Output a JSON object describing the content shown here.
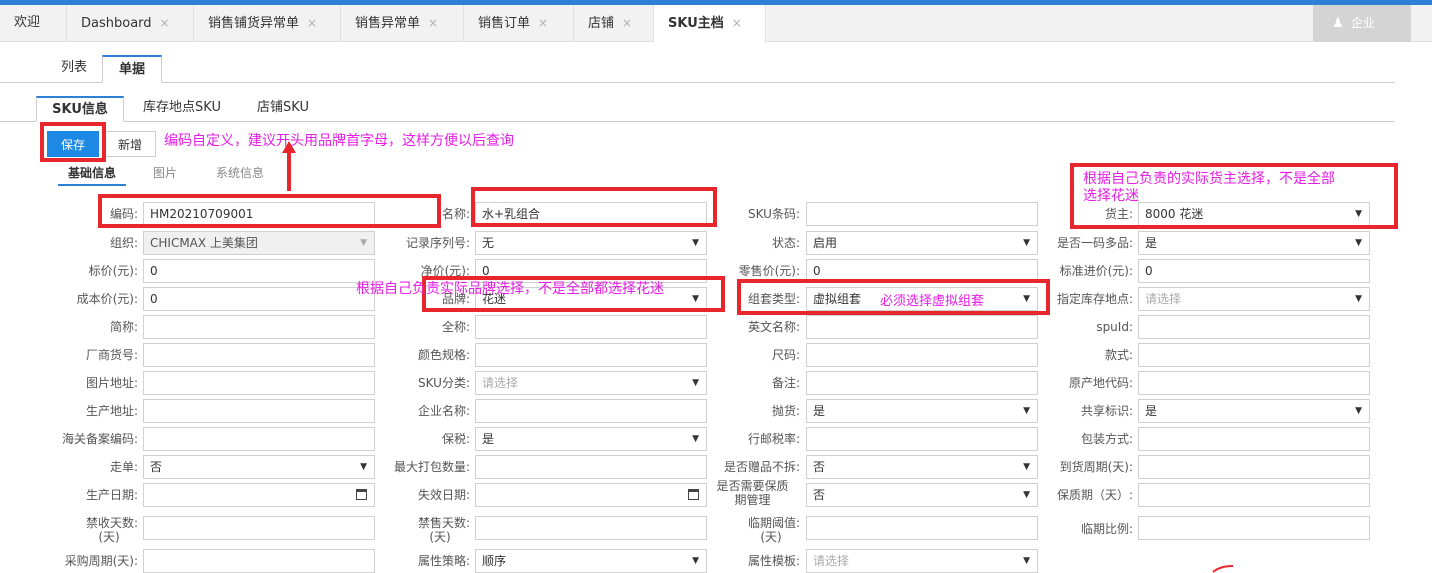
{
  "tabs": [
    {
      "label": "欢迎",
      "closable": false
    },
    {
      "label": "Dashboard",
      "closable": true
    },
    {
      "label": "销售铺货异常单",
      "closable": true
    },
    {
      "label": "销售异常单",
      "closable": true
    },
    {
      "label": "销售订单",
      "closable": true
    },
    {
      "label": "店铺",
      "closable": true
    },
    {
      "label": "SKU主档",
      "closable": true,
      "active": true
    }
  ],
  "close_glyph": "×",
  "user_corner": {
    "icon": "user-icon",
    "text": "企业"
  },
  "view_tabs": [
    "列表",
    "单据"
  ],
  "sku_tabs": [
    "SKU信息",
    "库存地点SKU",
    "店铺SKU"
  ],
  "buttons": {
    "save": "保存",
    "new": "新增"
  },
  "info_tabs": [
    "基础信息",
    "图片",
    "系统信息"
  ],
  "fields": {
    "code": {
      "label": "编码:",
      "value": "HM20210709001"
    },
    "name": {
      "label": "名称:",
      "value": "水+乳组合"
    },
    "sku_barcode": {
      "label": "SKU条码:",
      "value": ""
    },
    "owner": {
      "label": "货主:",
      "value": "8000 花迷"
    },
    "org": {
      "label": "组织:",
      "value": "CHICMAX 上美集团"
    },
    "serial_no": {
      "label": "记录序列号:",
      "value": "无"
    },
    "status": {
      "label": "状态:",
      "value": "启用"
    },
    "one_code_multi": {
      "label": "是否一码多品:",
      "value": "是"
    },
    "list_price": {
      "label": "标价(元):",
      "value": "0"
    },
    "net_price": {
      "label": "净价(元):",
      "value": "0"
    },
    "retail_price": {
      "label": "零售价(元):",
      "value": "0"
    },
    "std_cost_in": {
      "label": "标准进价(元):",
      "value": "0"
    },
    "cost_price": {
      "label": "成本价(元):",
      "value": "0"
    },
    "brand": {
      "label": "品牌:",
      "value": "花迷"
    },
    "kit_type": {
      "label": "组套类型:",
      "value": "虚拟组套"
    },
    "stock_location": {
      "label": "指定库存地点:",
      "placeholder": "请选择"
    },
    "short_name": {
      "label": "简称:",
      "value": ""
    },
    "full_name": {
      "label": "全称:",
      "value": ""
    },
    "english_name": {
      "label": "英文名称:",
      "value": ""
    },
    "spuid": {
      "label": "spuId:",
      "value": ""
    },
    "vendor_no": {
      "label": "厂商货号:",
      "value": ""
    },
    "color_spec": {
      "label": "颜色规格:",
      "value": ""
    },
    "size": {
      "label": "尺码:",
      "value": ""
    },
    "style": {
      "label": "款式:",
      "value": ""
    },
    "image_url": {
      "label": "图片地址:",
      "value": ""
    },
    "sku_category": {
      "label": "SKU分类:",
      "placeholder": "请选择"
    },
    "remark": {
      "label": "备注:",
      "value": ""
    },
    "origin_code": {
      "label": "原产地代码:",
      "value": ""
    },
    "prod_address": {
      "label": "生产地址:",
      "value": ""
    },
    "company": {
      "label": "企业名称:",
      "value": ""
    },
    "throw_goods": {
      "label": "抛货:",
      "value": "是"
    },
    "shared_flag": {
      "label": "共享标识:",
      "value": "是"
    },
    "customs_code": {
      "label": "海关备案编码:",
      "value": ""
    },
    "bonded": {
      "label": "保税:",
      "value": "是"
    },
    "postal_tax": {
      "label": "行邮税率:",
      "value": ""
    },
    "packing": {
      "label": "包装方式:",
      "value": ""
    },
    "walk_order": {
      "label": "走单:",
      "value": "否"
    },
    "max_pack_qty": {
      "label": "最大打包数量:",
      "value": ""
    },
    "gift_no_split": {
      "label": "是否赠品不拆:",
      "value": "否"
    },
    "arrival_cycle": {
      "label": "到货周期(天):",
      "value": ""
    },
    "prod_date": {
      "label": "生产日期:",
      "value": ""
    },
    "expiry_date": {
      "label": "失效日期:",
      "value": ""
    },
    "shelf_mgmt": {
      "label_line1": "是否需要保质",
      "label_line2": "期管理",
      "value": "否"
    },
    "shelf_life": {
      "label": "保质期（天）:",
      "value": ""
    },
    "no_receive_days": {
      "label_line1": "禁收天数:",
      "label_line2": "(天)",
      "value": ""
    },
    "no_sell_days": {
      "label_line1": "禁售天数:",
      "label_line2": "(天)",
      "value": ""
    },
    "near_expiry_threshold": {
      "label_line1": "临期阈值:",
      "label_line2": "(天)",
      "value": ""
    },
    "near_expiry_ratio": {
      "label": "临期比例:",
      "value": ""
    },
    "purchase_cycle": {
      "label": "采购周期(天):",
      "value": ""
    },
    "attr_strategy": {
      "label": "属性策略:",
      "value": "顺序"
    },
    "attr_template": {
      "label": "属性模板:",
      "placeholder": "请选择"
    }
  },
  "annotations": {
    "code_note": "编码自定义，建议开头用品牌首字母，这样方便以后查询",
    "owner_note_line1": "根据自己负责的实际货主选择，不是全部",
    "owner_note_line2": "选择花迷",
    "brand_note": "根据自己负责实际品牌选择，不是全部都选择花迷",
    "kit_note": "必须选择虚拟组套"
  },
  "colors": {
    "accent": "#1e88e5",
    "annotation_box": "#e8262d",
    "annotation_text": "#e61ee6"
  }
}
